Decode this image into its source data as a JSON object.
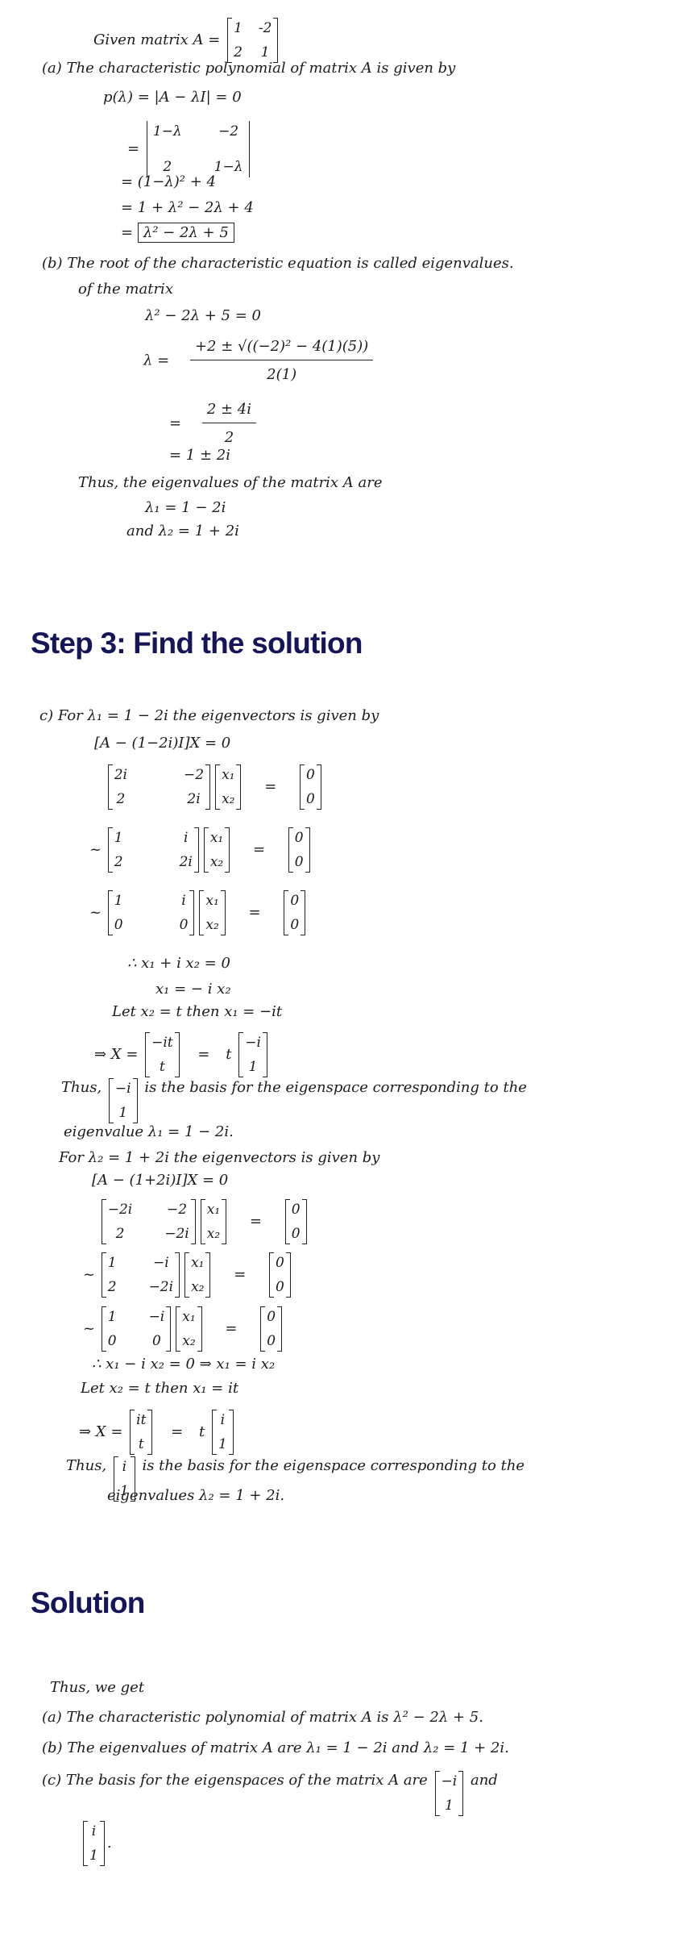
{
  "part1": {
    "given_label": "Given matrix A =",
    "matrix_A": [
      [
        "1",
        "-2"
      ],
      [
        "2",
        "1"
      ]
    ],
    "a_intro": "(a) The characteristic polynomial of matrix A is given by",
    "p_def": "p(λ) = |A − λI| = 0",
    "eq": "=",
    "det": [
      [
        "1−λ",
        "−2"
      ],
      [
        "2",
        "1−λ"
      ]
    ],
    "step_square": "= (1−λ)² + 4",
    "step_expand": "= 1 + λ² − 2λ + 4",
    "boxed_result": "λ² − 2λ + 5",
    "b_intro": "(b) The root of the characteristic equation is called eigenvalues.",
    "b_intro2": "of the matrix",
    "char_eq": "λ² − 2λ + 5 = 0",
    "lambda_eq": "λ =",
    "quad_num": "+2 ± √((−2)² − 4(1)(5))",
    "quad_den": "2(1)",
    "frac2_num": "2 ± 4i",
    "frac2_den": "2",
    "roots": "= 1 ± 2i",
    "thus": "Thus, the eigenvalues of the matrix A are",
    "lambda1": "λ₁ = 1 − 2i",
    "lambda2": "and λ₂ = 1 + 2i"
  },
  "heading_step3": "Step 3: Find the solution",
  "part2": {
    "c_intro": "c) For λ₁ = 1 − 2i the eigenvectors is given by",
    "system1": "[A − (1−2i)I]X = 0",
    "m1": [
      [
        "2i",
        "−2"
      ],
      [
        "2",
        "2i"
      ]
    ],
    "m2": [
      [
        "1",
        "i"
      ],
      [
        "2",
        "2i"
      ]
    ],
    "m3": [
      [
        "1",
        "i"
      ],
      [
        "0",
        "0"
      ]
    ],
    "xvec": [
      [
        "x₁"
      ],
      [
        "x₂"
      ]
    ],
    "zero": [
      [
        "0"
      ],
      [
        "0"
      ]
    ],
    "tilde": "~",
    "equals": "=",
    "therefore1": "∴ x₁ + i x₂ = 0",
    "x1_eq": "x₁ = − i x₂",
    "let1": "Let x₂ = t   then x₁ = −it",
    "implies_x": "⇒ X =",
    "vec_it1": [
      [
        "−it"
      ],
      [
        "t"
      ]
    ],
    "t": "t",
    "basis1": [
      [
        "−i"
      ],
      [
        "1"
      ]
    ],
    "thus1_a": "Thus,",
    "thus1_b": "is the basis for the eigenspace corresponding to the",
    "thus1_c": "eigenvalue  λ₁ = 1 − 2i.",
    "for2": "For λ₂ = 1 + 2i the eigenvectors is given by",
    "system2": "[A − (1+2i)I]X = 0",
    "n1": [
      [
        "−2i",
        "−2"
      ],
      [
        "2",
        "−2i"
      ]
    ],
    "n2": [
      [
        "1",
        "−i"
      ],
      [
        "2",
        "−2i"
      ]
    ],
    "n3": [
      [
        "1",
        "−i"
      ],
      [
        "0",
        "0"
      ]
    ],
    "therefore2": "∴ x₁ − i x₂ = 0  ⇒  x₁ = i x₂",
    "let2": "Let x₂ = t then x₁ = it",
    "vec_it2": [
      [
        "it"
      ],
      [
        "t"
      ]
    ],
    "basis2": [
      [
        "i"
      ],
      [
        "1"
      ]
    ],
    "thus2_b": "is the basis for the eigenspace corresponding to the",
    "thus2_c": "eigenvalues λ₂ = 1 + 2i."
  },
  "heading_solution": "Solution",
  "part3": {
    "intro": "Thus, we get",
    "a": "(a) The characteristic polynomial of matrix A is λ² − 2λ + 5.",
    "b": "(b) The eigenvalues of matrix A are  λ₁ = 1 − 2i and λ₂ = 1 + 2i.",
    "c": "(c) The basis for the eigenspaces of the matrix A are",
    "and": "and",
    "period": ".",
    "basis1": [
      [
        "−i"
      ],
      [
        "1"
      ]
    ],
    "basis2": [
      [
        "i"
      ],
      [
        "1"
      ]
    ]
  }
}
